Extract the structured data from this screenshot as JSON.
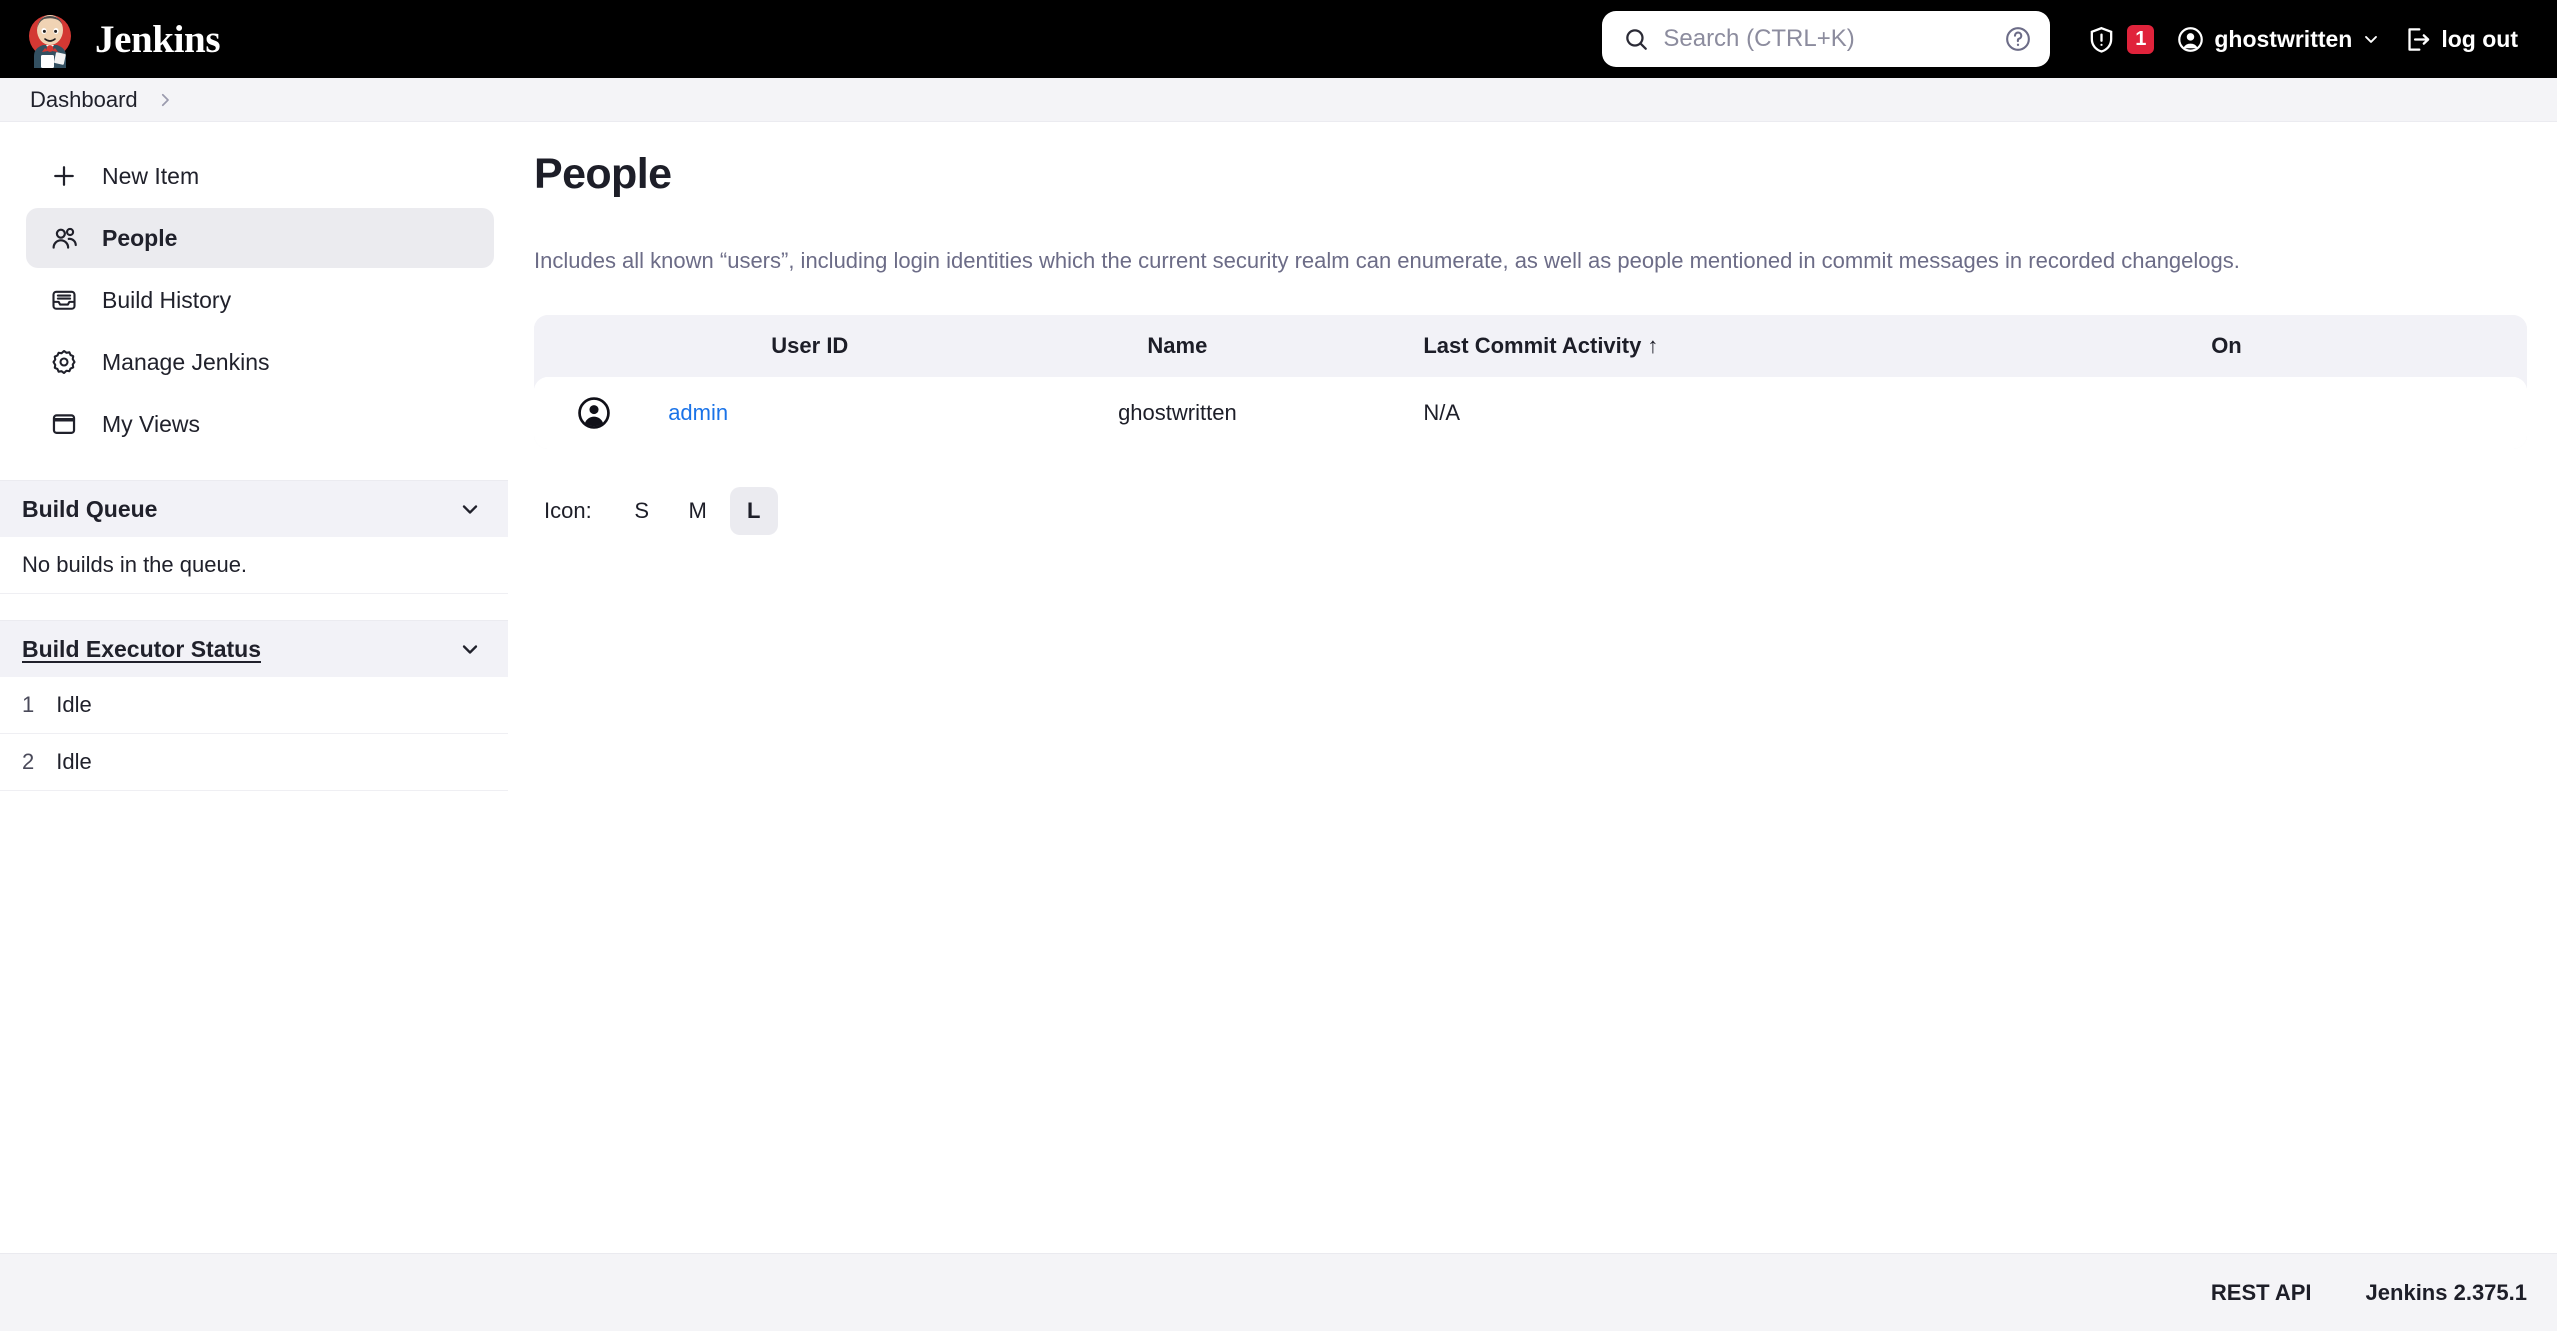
{
  "header": {
    "brand_name": "Jenkins",
    "brand_logo_icon": "jenkins-butler-logo",
    "search": {
      "placeholder": "Search (CTRL+K)",
      "value": "",
      "search_icon": "search-icon",
      "help_icon": "help-circle-icon"
    },
    "security": {
      "shield_icon": "shield-exclamation-icon",
      "badge_count": "1",
      "badge_color": "#e0233b"
    },
    "user": {
      "avatar_icon": "user-circle-icon",
      "name": "ghostwritten",
      "chevron_icon": "chevron-down-icon"
    },
    "logout": {
      "icon": "logout-icon",
      "label": "log out"
    }
  },
  "breadcrumb": {
    "items": [
      {
        "label": "Dashboard"
      }
    ],
    "separator_icon": "chevron-right-icon"
  },
  "sidebar": {
    "items": [
      {
        "label": "New Item",
        "icon": "plus-icon",
        "active": false
      },
      {
        "label": "People",
        "icon": "people-icon",
        "active": true
      },
      {
        "label": "Build History",
        "icon": "inbox-icon",
        "active": false
      },
      {
        "label": "Manage Jenkins",
        "icon": "gear-icon",
        "active": false
      },
      {
        "label": "My Views",
        "icon": "window-icon",
        "active": false
      }
    ],
    "build_queue": {
      "title": "Build Queue",
      "chevron_icon": "chevron-down-icon",
      "empty_text": "No builds in the queue."
    },
    "build_executor_status": {
      "title": "Build Executor Status",
      "chevron_icon": "chevron-down-icon",
      "executors": [
        {
          "number": "1",
          "status": "Idle"
        },
        {
          "number": "2",
          "status": "Idle"
        }
      ]
    }
  },
  "main": {
    "title": "People",
    "description": "Includes all known “users”, including login identities which the current security realm can enumerate, as well as people mentioned in commit messages in recorded changelogs.",
    "table": {
      "columns": [
        {
          "key": "icon",
          "label": ""
        },
        {
          "key": "user",
          "label": "User ID"
        },
        {
          "key": "name",
          "label": "Name"
        },
        {
          "key": "activity",
          "label": "Last Commit Activity"
        },
        {
          "key": "on",
          "label": "On"
        }
      ],
      "sort": {
        "column": "Last Commit Activity",
        "arrow": "↑",
        "direction": "ascending"
      },
      "rows": [
        {
          "avatar_icon": "user-circle-icon",
          "user_id": "admin",
          "name": "ghostwritten",
          "last_commit_activity": "N/A",
          "on": ""
        }
      ]
    },
    "icon_size": {
      "label": "Icon:",
      "options": [
        {
          "label": "S",
          "selected": false
        },
        {
          "label": "M",
          "selected": false
        },
        {
          "label": "L",
          "selected": true
        }
      ]
    }
  },
  "footer": {
    "rest_api_label": "REST API",
    "version": "Jenkins 2.375.1"
  },
  "colors": {
    "header_bg": "#000000",
    "accent_link": "#1a73e8",
    "badge_red": "#e0233b",
    "panel_bg": "#f2f2f7",
    "active_nav": "#ebebef"
  }
}
